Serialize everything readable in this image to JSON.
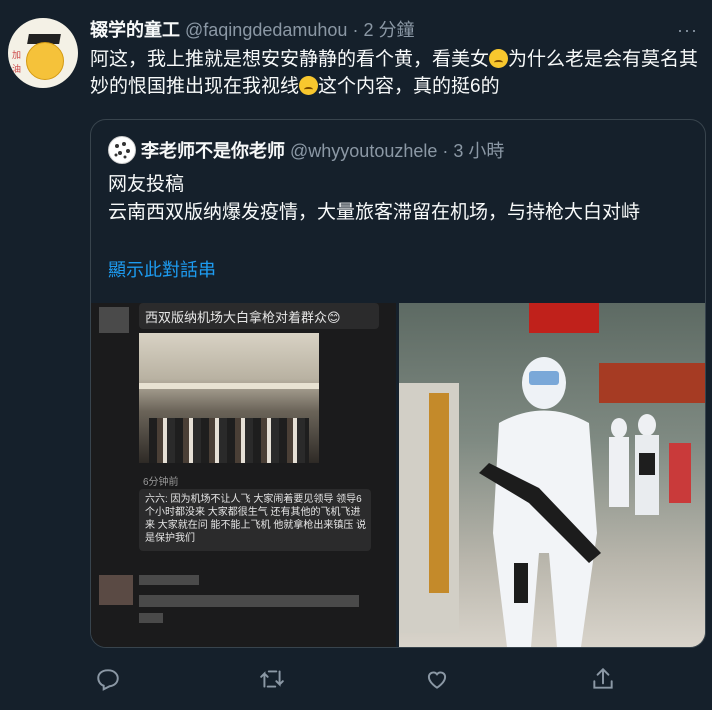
{
  "tweet": {
    "display_name": "辍学的童工",
    "handle": "@faqingdedamuhou",
    "separator": "·",
    "time": "2 分鐘",
    "more_label": "···",
    "text_part1": "阿这，我上推就是想安安静静的看个黄，看美女",
    "text_part2": "为什么老是会有莫名其妙的恨国推出现在我视线",
    "text_part3": "这个内容，真的挺6的"
  },
  "quoted": {
    "display_name": "李老师不是你老师",
    "handle": "@whyyoutouzhele",
    "separator": "·",
    "time": "3 小時",
    "line1": "网友投稿",
    "line2": "云南西双版纳爆发疫情，大量旅客滞留在机场，与持枪大白对峙",
    "show_thread": "顯示此對話串"
  },
  "media_left": {
    "caption": "西双版纳机场大白拿枪对着群众😊",
    "timestamp": "6分钟前",
    "comment": "六六: 因为机场不让人飞 大家闹着要见领导 领导6个小时都没来 大家都很生气 还有其他的飞机飞进来 大家就在问 能不能上飞机 他就拿枪出来镇压 说是保护我们"
  },
  "icons": {
    "reply": "reply-icon",
    "retweet": "retweet-icon",
    "like": "like-icon",
    "share": "share-icon"
  },
  "colors": {
    "background": "#15202b",
    "accent": "#1d9bf0",
    "muted": "#8b98a5"
  }
}
